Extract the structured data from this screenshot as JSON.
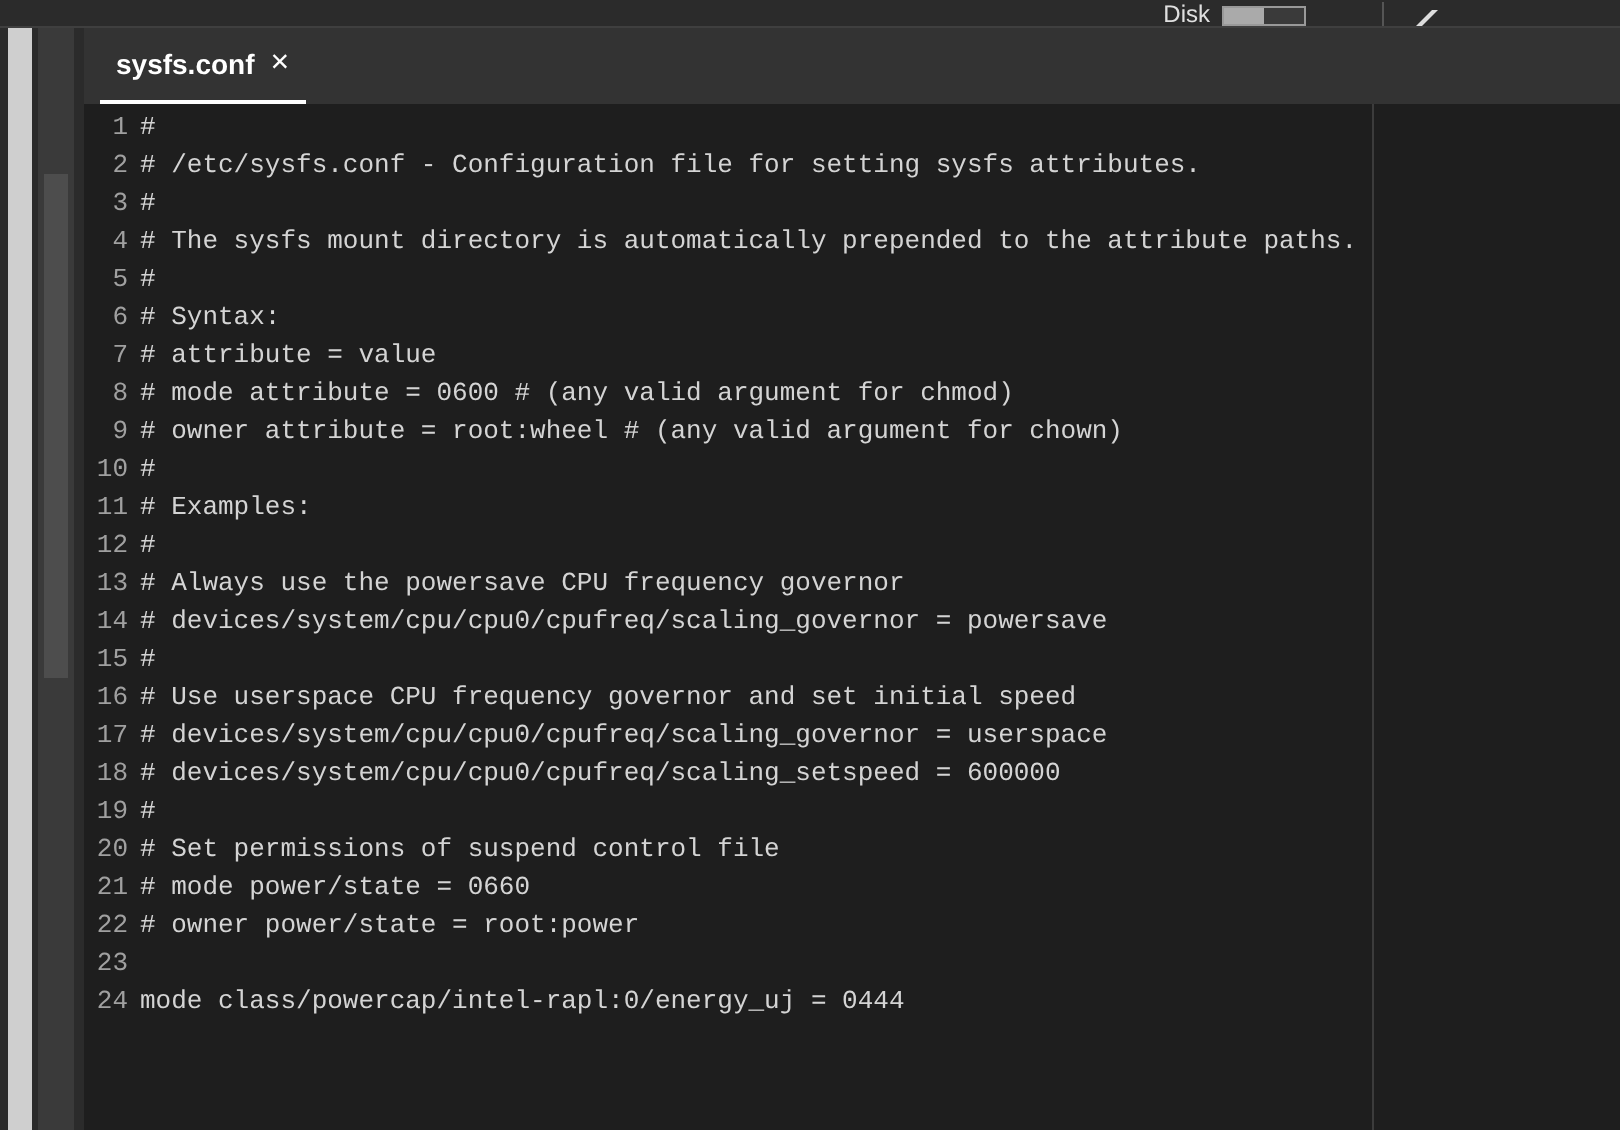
{
  "top_bar": {
    "disk_label": "Disk",
    "disk_switch": {
      "on": false
    }
  },
  "tabs": [
    {
      "label": "sysfs.conf",
      "close": "×",
      "selected": true
    }
  ],
  "editor": {
    "lines": [
      {
        "number": "1",
        "text": "#"
      },
      {
        "number": "2",
        "text": "# /etc/sysfs.conf - Configuration file for setting sysfs attributes."
      },
      {
        "number": "3",
        "text": "#"
      },
      {
        "number": "4",
        "text": "# The sysfs mount directory is automatically prepended to the attribute paths."
      },
      {
        "number": "5",
        "text": "#"
      },
      {
        "number": "6",
        "text": "# Syntax:"
      },
      {
        "number": "7",
        "text": "# attribute = value"
      },
      {
        "number": "8",
        "text": "# mode attribute = 0600 # (any valid argument for chmod)"
      },
      {
        "number": "9",
        "text": "# owner attribute = root:wheel # (any valid argument for chown)"
      },
      {
        "number": "10",
        "text": "#"
      },
      {
        "number": "11",
        "text": "# Examples:"
      },
      {
        "number": "12",
        "text": "#"
      },
      {
        "number": "13",
        "text": "# Always use the powersave CPU frequency governor"
      },
      {
        "number": "14",
        "text": "# devices/system/cpu/cpu0/cpufreq/scaling_governor = powersave"
      },
      {
        "number": "15",
        "text": "#"
      },
      {
        "number": "16",
        "text": "# Use userspace CPU frequency governor and set initial speed"
      },
      {
        "number": "17",
        "text": "# devices/system/cpu/cpu0/cpufreq/scaling_governor = userspace"
      },
      {
        "number": "18",
        "text": "# devices/system/cpu/cpu0/cpufreq/scaling_setspeed = 600000"
      },
      {
        "number": "19",
        "text": "#"
      },
      {
        "number": "20",
        "text": "# Set permissions of suspend control file"
      },
      {
        "number": "21",
        "text": "# mode power/state = 0660"
      },
      {
        "number": "22",
        "text": "# owner power/state = root:power"
      },
      {
        "number": "23"
      },
      {
        "number": "24",
        "text": "mode class/powercap/intel-rapl:0/energy_uj = 0444"
      }
    ]
  }
}
